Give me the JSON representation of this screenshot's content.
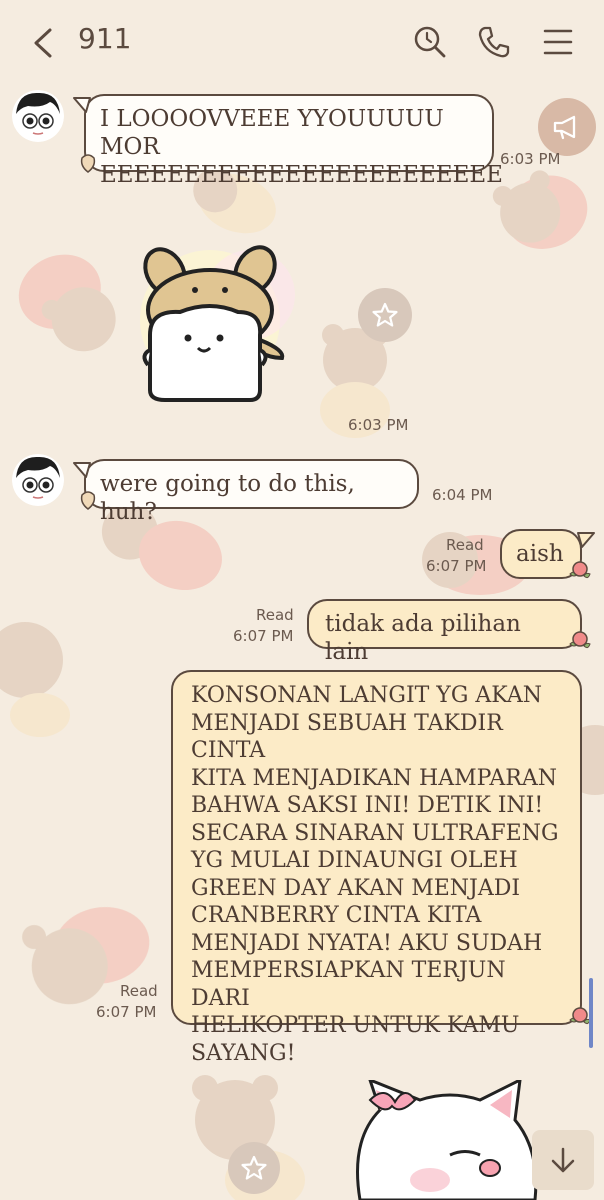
{
  "header": {
    "title": "911",
    "icons": [
      "back-icon",
      "search-icon",
      "call-icon",
      "menu-icon"
    ]
  },
  "messages": [
    {
      "sender": "other",
      "text_line1": "I LOOOOVVEEE YYOUUUUU MOR",
      "text_line2": "EEEEEEEEEEEEEEEEEEEEEEEE",
      "time": "6:03 PM"
    },
    {
      "sender": "other",
      "type": "sticker",
      "time": "6:03 PM"
    },
    {
      "sender": "other",
      "text": "were going to do this, huh?",
      "time": "6:04 PM"
    },
    {
      "sender": "me",
      "text": "aish",
      "read": "Read",
      "time": "6:07 PM"
    },
    {
      "sender": "me",
      "text": "tidak ada pilihan lain",
      "read": "Read",
      "time": "6:07 PM"
    },
    {
      "sender": "me",
      "lines": [
        "KONSONAN LANGIT YG AKAN",
        "MENJADI SEBUAH TAKDIR CINTA",
        "KITA MENJADIKAN HAMPARAN",
        "BAHWA SAKSI INI! DETIK INI!",
        "SECARA SINARAN ULTRAFENG",
        "YG MULAI DINAUNGI OLEH",
        "GREEN DAY AKAN MENJADI",
        "CRANBERRY CINTA KITA",
        "MENJADI NYATA! AKU SUDAH",
        "MEMPERSIAPKAN TERJUN DARI",
        "HELIKOPTER UNTUK KAMU",
        "SAYANG!"
      ],
      "read": "Read",
      "time": "6:07 PM"
    }
  ],
  "colors": {
    "background": "#f5ece0",
    "bubble_mine": "#fcebc7",
    "bubble_other": "#fffdf9",
    "text": "#5b4a3f"
  }
}
